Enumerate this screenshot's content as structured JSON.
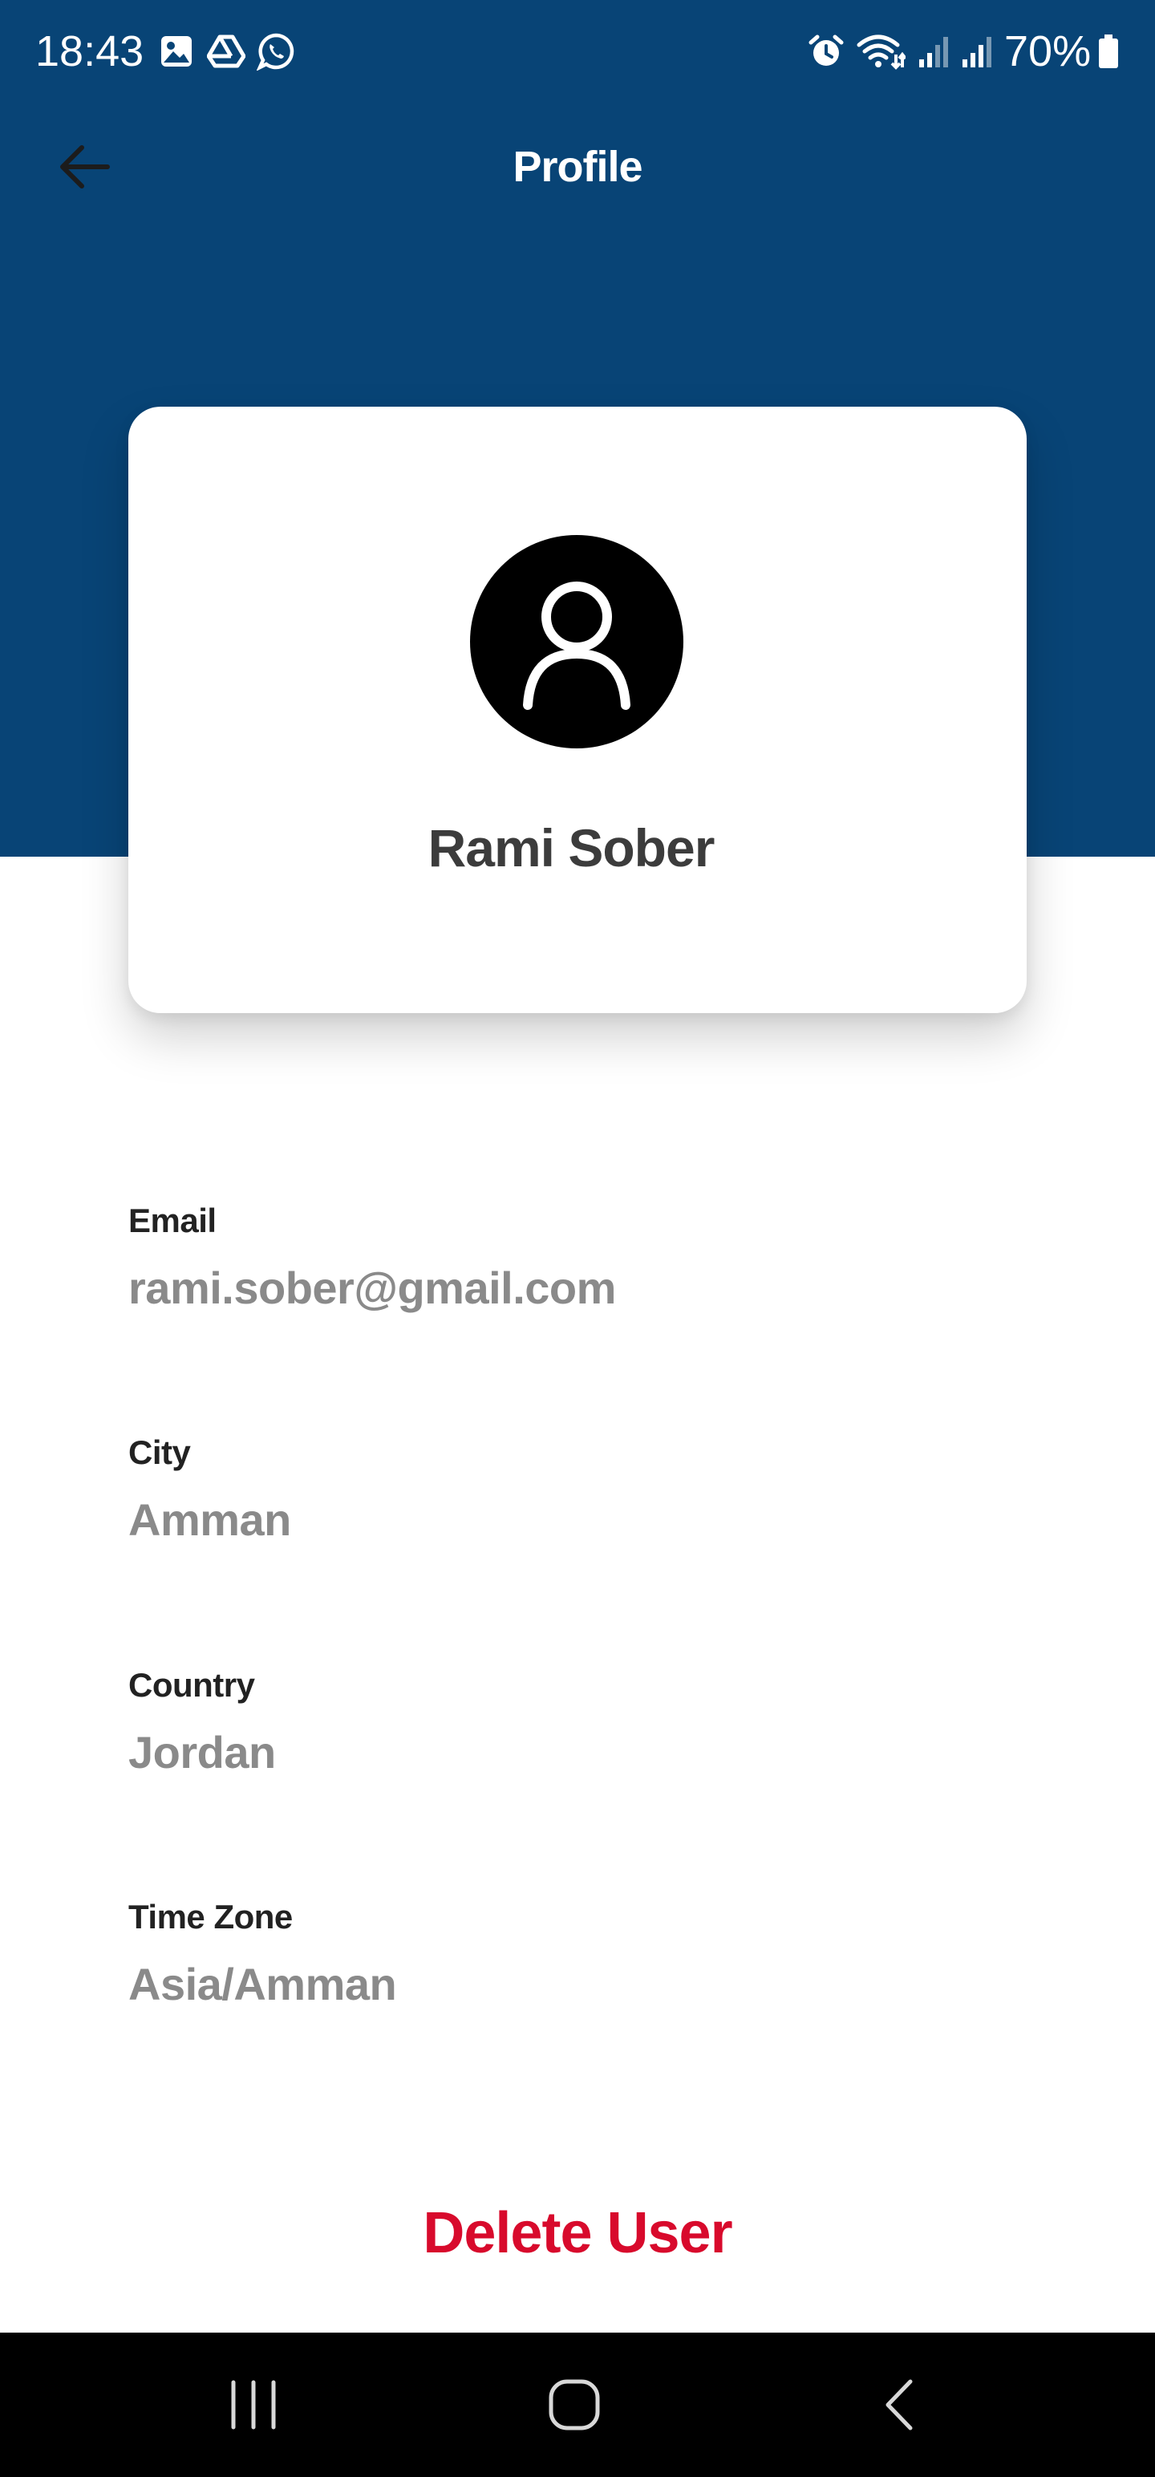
{
  "status_bar": {
    "time": "18:43",
    "left_icons": [
      "gallery-icon",
      "drive-icon",
      "whatsapp-icon"
    ],
    "right_icons": [
      "alarm-icon",
      "wifi-icon",
      "signal-icon",
      "signal-icon"
    ],
    "battery_percent": "70%"
  },
  "app_bar": {
    "title": "Profile",
    "back_icon": "arrow-left-icon"
  },
  "colors": {
    "header": "#084476",
    "delete": "#d80a2c",
    "value_text": "#8a8a8a"
  },
  "profile": {
    "avatar_icon": "user-icon",
    "name": "Rami Sober"
  },
  "fields": [
    {
      "label": "Email",
      "value": "rami.sober@gmail.com"
    },
    {
      "label": "City",
      "value": "Amman"
    },
    {
      "label": "Country",
      "value": "Jordan"
    },
    {
      "label": "Time Zone",
      "value": "Asia/Amman"
    }
  ],
  "actions": {
    "delete_label": "Delete User"
  },
  "nav_bar": {
    "icons": [
      "recent-apps-icon",
      "home-icon",
      "back-icon"
    ]
  }
}
